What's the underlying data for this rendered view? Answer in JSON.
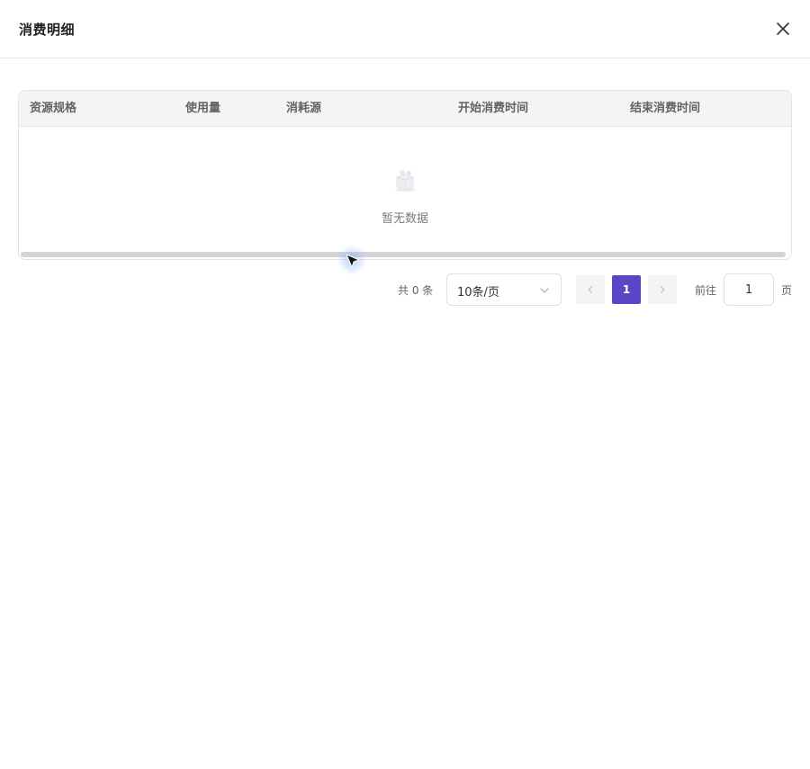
{
  "dialog": {
    "title": "消费明细"
  },
  "icons": {
    "close": "close-icon",
    "empty": "empty-box-icon",
    "select_arrow": "chevron-down-icon",
    "prev": "chevron-left-icon",
    "next": "chevron-right-icon"
  },
  "table": {
    "columns": [
      "资源规格",
      "使用量",
      "消耗源",
      "开始消费时间",
      "结束消费时间"
    ],
    "rows": [],
    "empty_text": "暂无数据"
  },
  "pagination": {
    "total_label": "共 0 条",
    "page_size_label": "10条/页",
    "current_page": "1",
    "goto_prefix": "前往",
    "goto_value": "1",
    "goto_suffix": "页"
  },
  "colors": {
    "accent": "#5a47c8",
    "header_bg": "#f4f4f5",
    "border": "#e4e4e8"
  }
}
